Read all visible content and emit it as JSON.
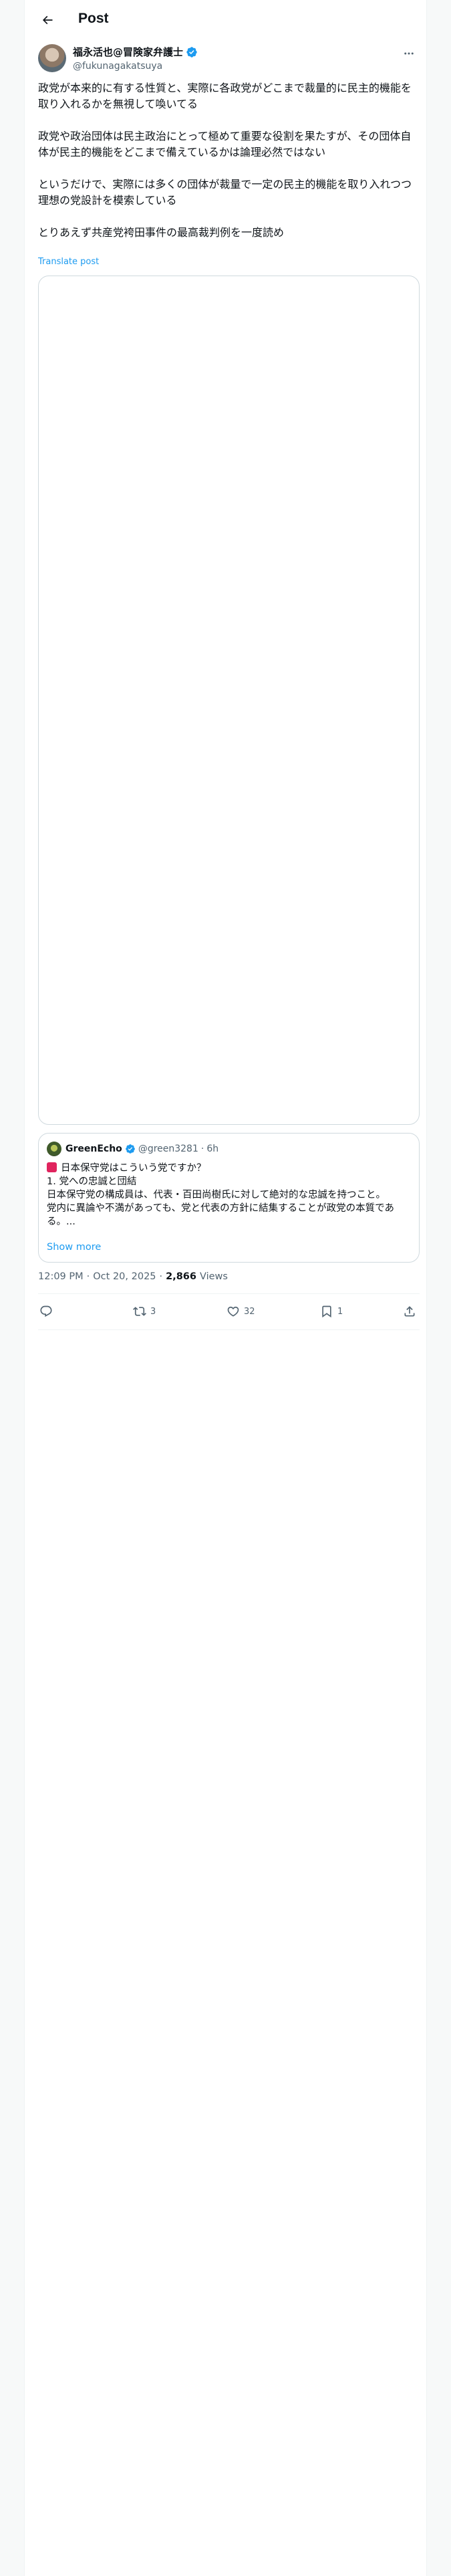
{
  "header": {
    "title": "Post",
    "back_icon": "arrow-left-icon"
  },
  "author": {
    "name": "福永活也@冒険家弁護士",
    "handle": "@fukunagakatsuya",
    "verified_color": "#1d9bf0"
  },
  "post": {
    "paragraphs": [
      "政党が本来的に有する性質と、実際に各政党がどこまで裁量的に民主的機能を取り入れるかを無視して喚いてる",
      "政党や政治団体は民主政治にとって極めて重要な役割を果たすが、その団体自体が民主的機能をどこまで備えているかは論理必然ではない",
      "というだけで、実際には多くの団体が裁量で一定の民主的機能を取り入れつつ理想の党設計を模索している",
      "とりあえず共産党袴田事件の最高裁判例を一度読め"
    ],
    "translate_label": "Translate post"
  },
  "quote": {
    "name": "GreenEcho",
    "handle": "@green3281",
    "separator": "·",
    "age": "6h",
    "lines": [
      "日本保守党はこういう党ですか？",
      "1. 党への忠誠と団結",
      "日本保守党の構成員は、代表・百田尚樹氏に対して絶対的な忠誠を持つこと。",
      "党内に異論や不満があっても、党と代表の方針に結集することが政党の本質である。..."
    ],
    "show_more_label": "Show more",
    "flag_color": "#e0245e"
  },
  "meta": {
    "time": "12:09 PM",
    "separator": "·",
    "date": "Oct 20, 2025",
    "separator2": "·",
    "views_count": "2,866",
    "views_label": "Views"
  },
  "actions": {
    "reply_count": "",
    "repost_count": "3",
    "like_count": "32",
    "bookmark_count": "1"
  },
  "colors": {
    "accent": "#1d9bf0",
    "text": "#0f1419",
    "secondary": "#536471",
    "border": "#cfd9de"
  }
}
